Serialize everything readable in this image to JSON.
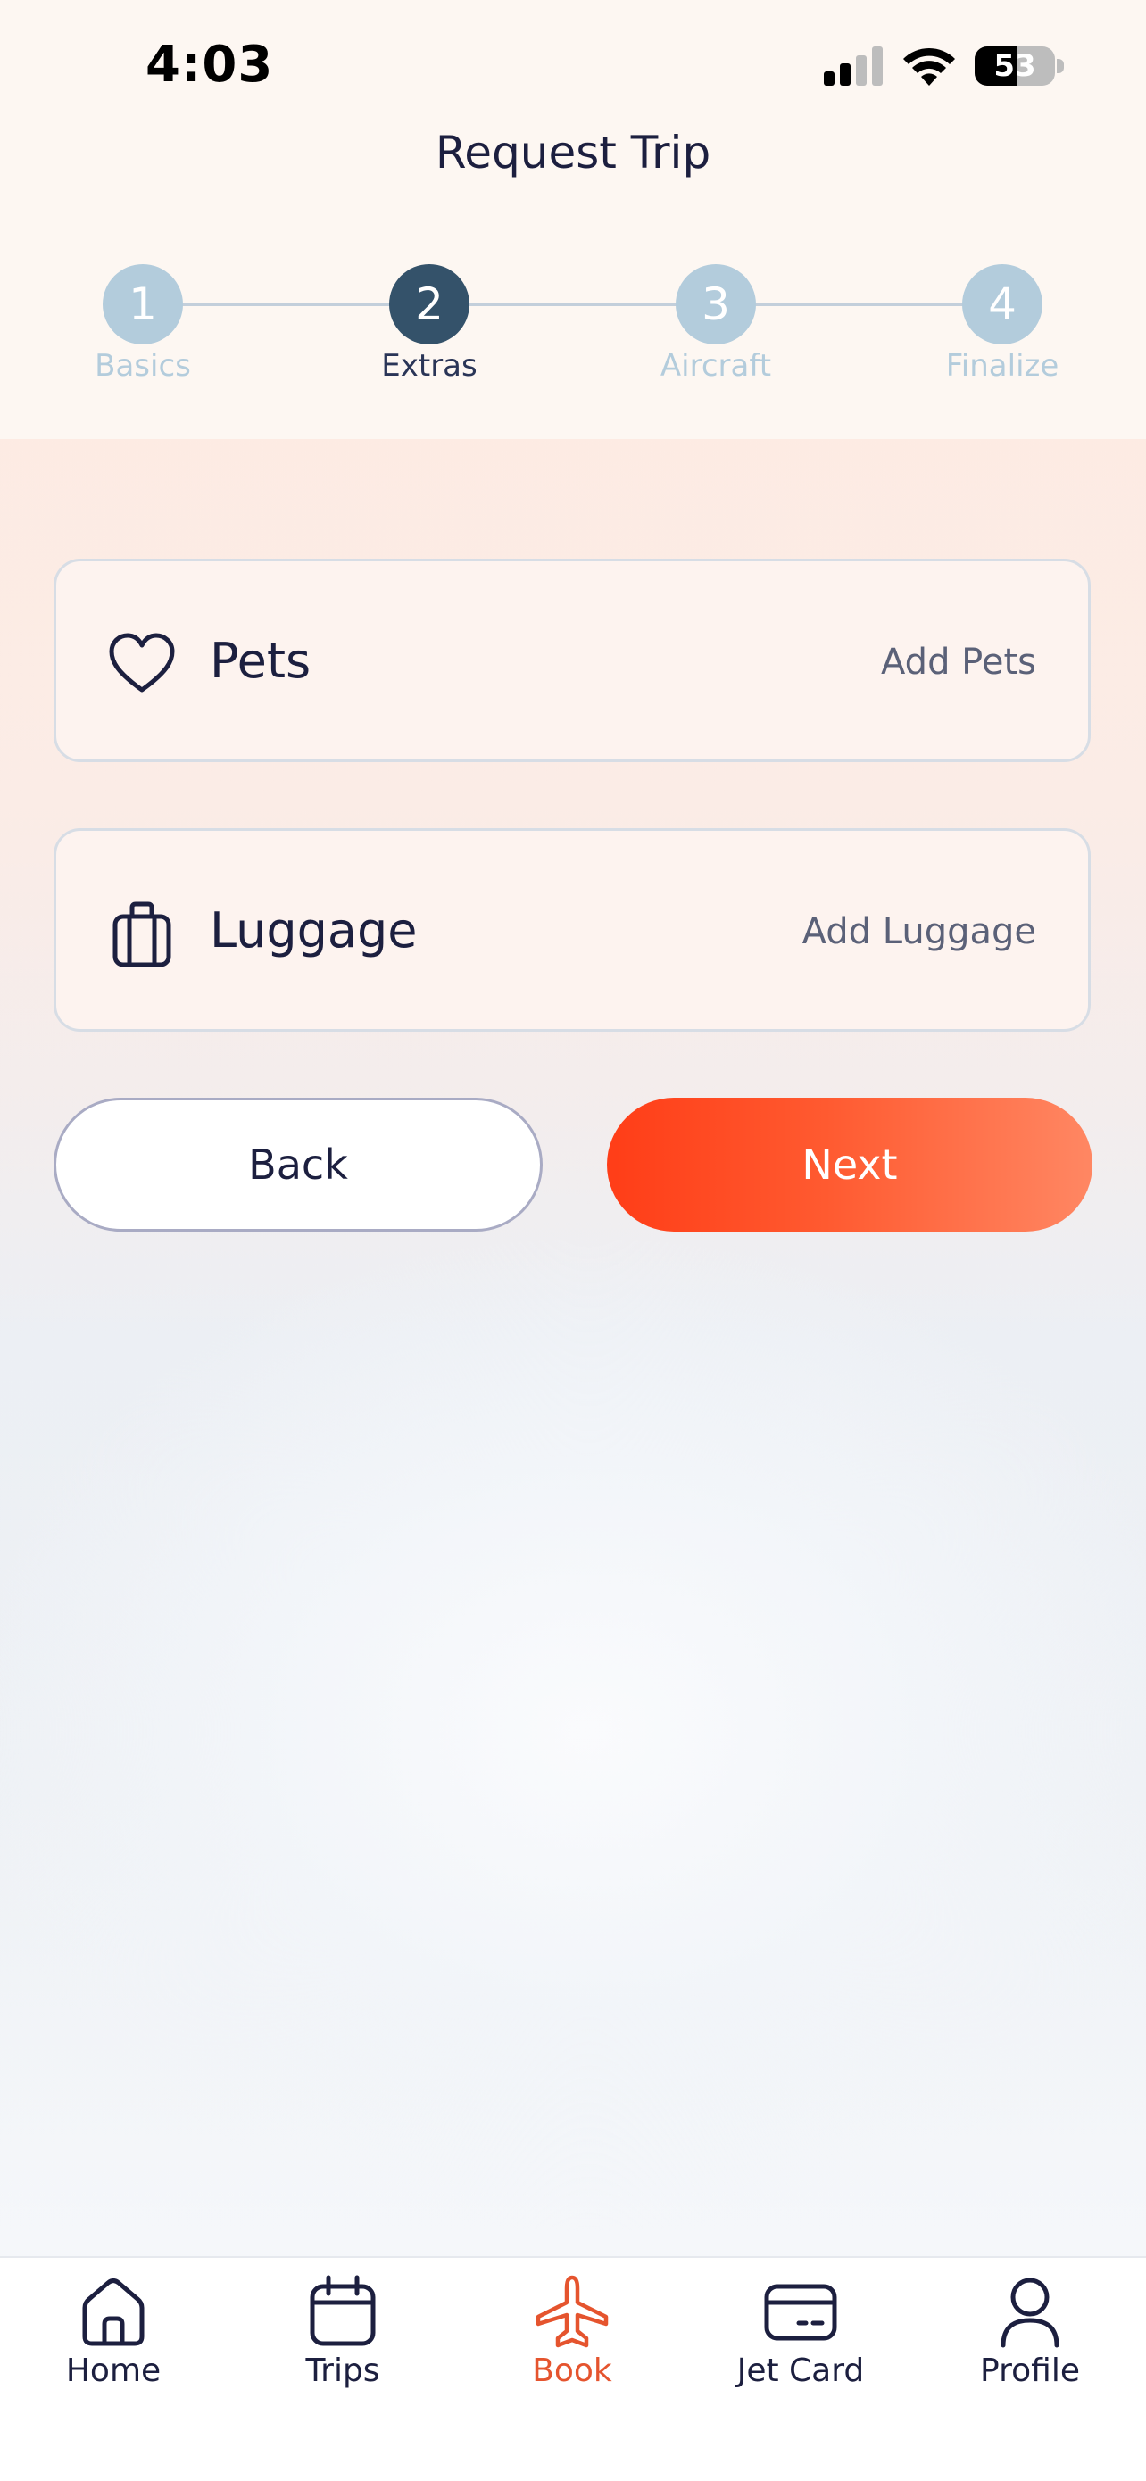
{
  "status_bar": {
    "time": "4:03",
    "battery_percent": "53",
    "battery_level": 0.53
  },
  "header": {
    "title": "Request Trip"
  },
  "stepper": {
    "active_step": 2,
    "steps": [
      {
        "number": "1",
        "label": "Basics"
      },
      {
        "number": "2",
        "label": "Extras"
      },
      {
        "number": "3",
        "label": "Aircraft"
      },
      {
        "number": "4",
        "label": "Finalize"
      }
    ]
  },
  "options": [
    {
      "label": "Pets",
      "action": "Add Pets",
      "icon": "heart-icon"
    },
    {
      "label": "Luggage",
      "action": "Add Luggage",
      "icon": "briefcase-icon"
    }
  ],
  "buttons": {
    "back": "Back",
    "next": "Next"
  },
  "tabbar": {
    "active": "Book",
    "items": [
      {
        "label": "Home",
        "icon": "home-icon"
      },
      {
        "label": "Trips",
        "icon": "calendar-icon"
      },
      {
        "label": "Book",
        "icon": "airplane-icon"
      },
      {
        "label": "Jet Card",
        "icon": "card-icon"
      },
      {
        "label": "Profile",
        "icon": "person-icon"
      }
    ]
  },
  "colors": {
    "accent": "#ff4a23",
    "navy": "#1c1f3f",
    "step_active": "#34526a",
    "step_inactive": "#b3ccdc",
    "tab_active": "#e5542e"
  }
}
